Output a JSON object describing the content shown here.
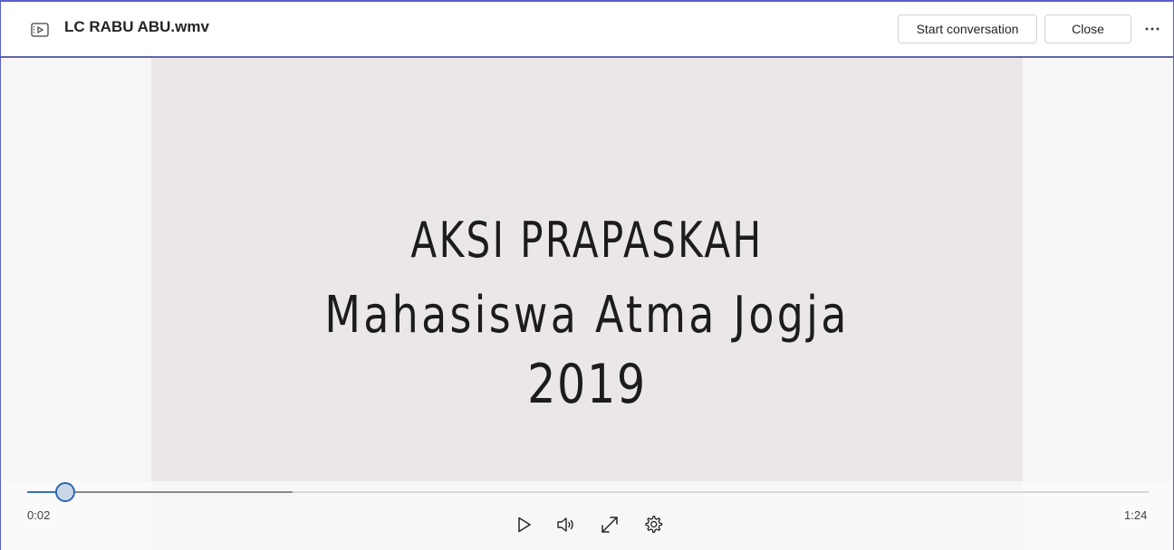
{
  "header": {
    "file_icon": "video-file-icon",
    "title": "LC RABU ABU.wmv",
    "start_conversation_label": "Start conversation",
    "close_label": "Close",
    "more_icon": "more-options-icon"
  },
  "video": {
    "line1": "AKSI PRAPASKAH",
    "line2": "Mahasiswa Atma Jogja",
    "line3": "2019"
  },
  "player": {
    "current_time": "0:02",
    "total_time": "1:24",
    "played_fraction": 0.033,
    "buffered_fraction": 0.237,
    "icons": [
      "play-icon",
      "volume-icon",
      "fullscreen-icon",
      "settings-icon"
    ]
  },
  "colors": {
    "accent_border": "#5b5fc7",
    "progress": "#2e66b0"
  }
}
